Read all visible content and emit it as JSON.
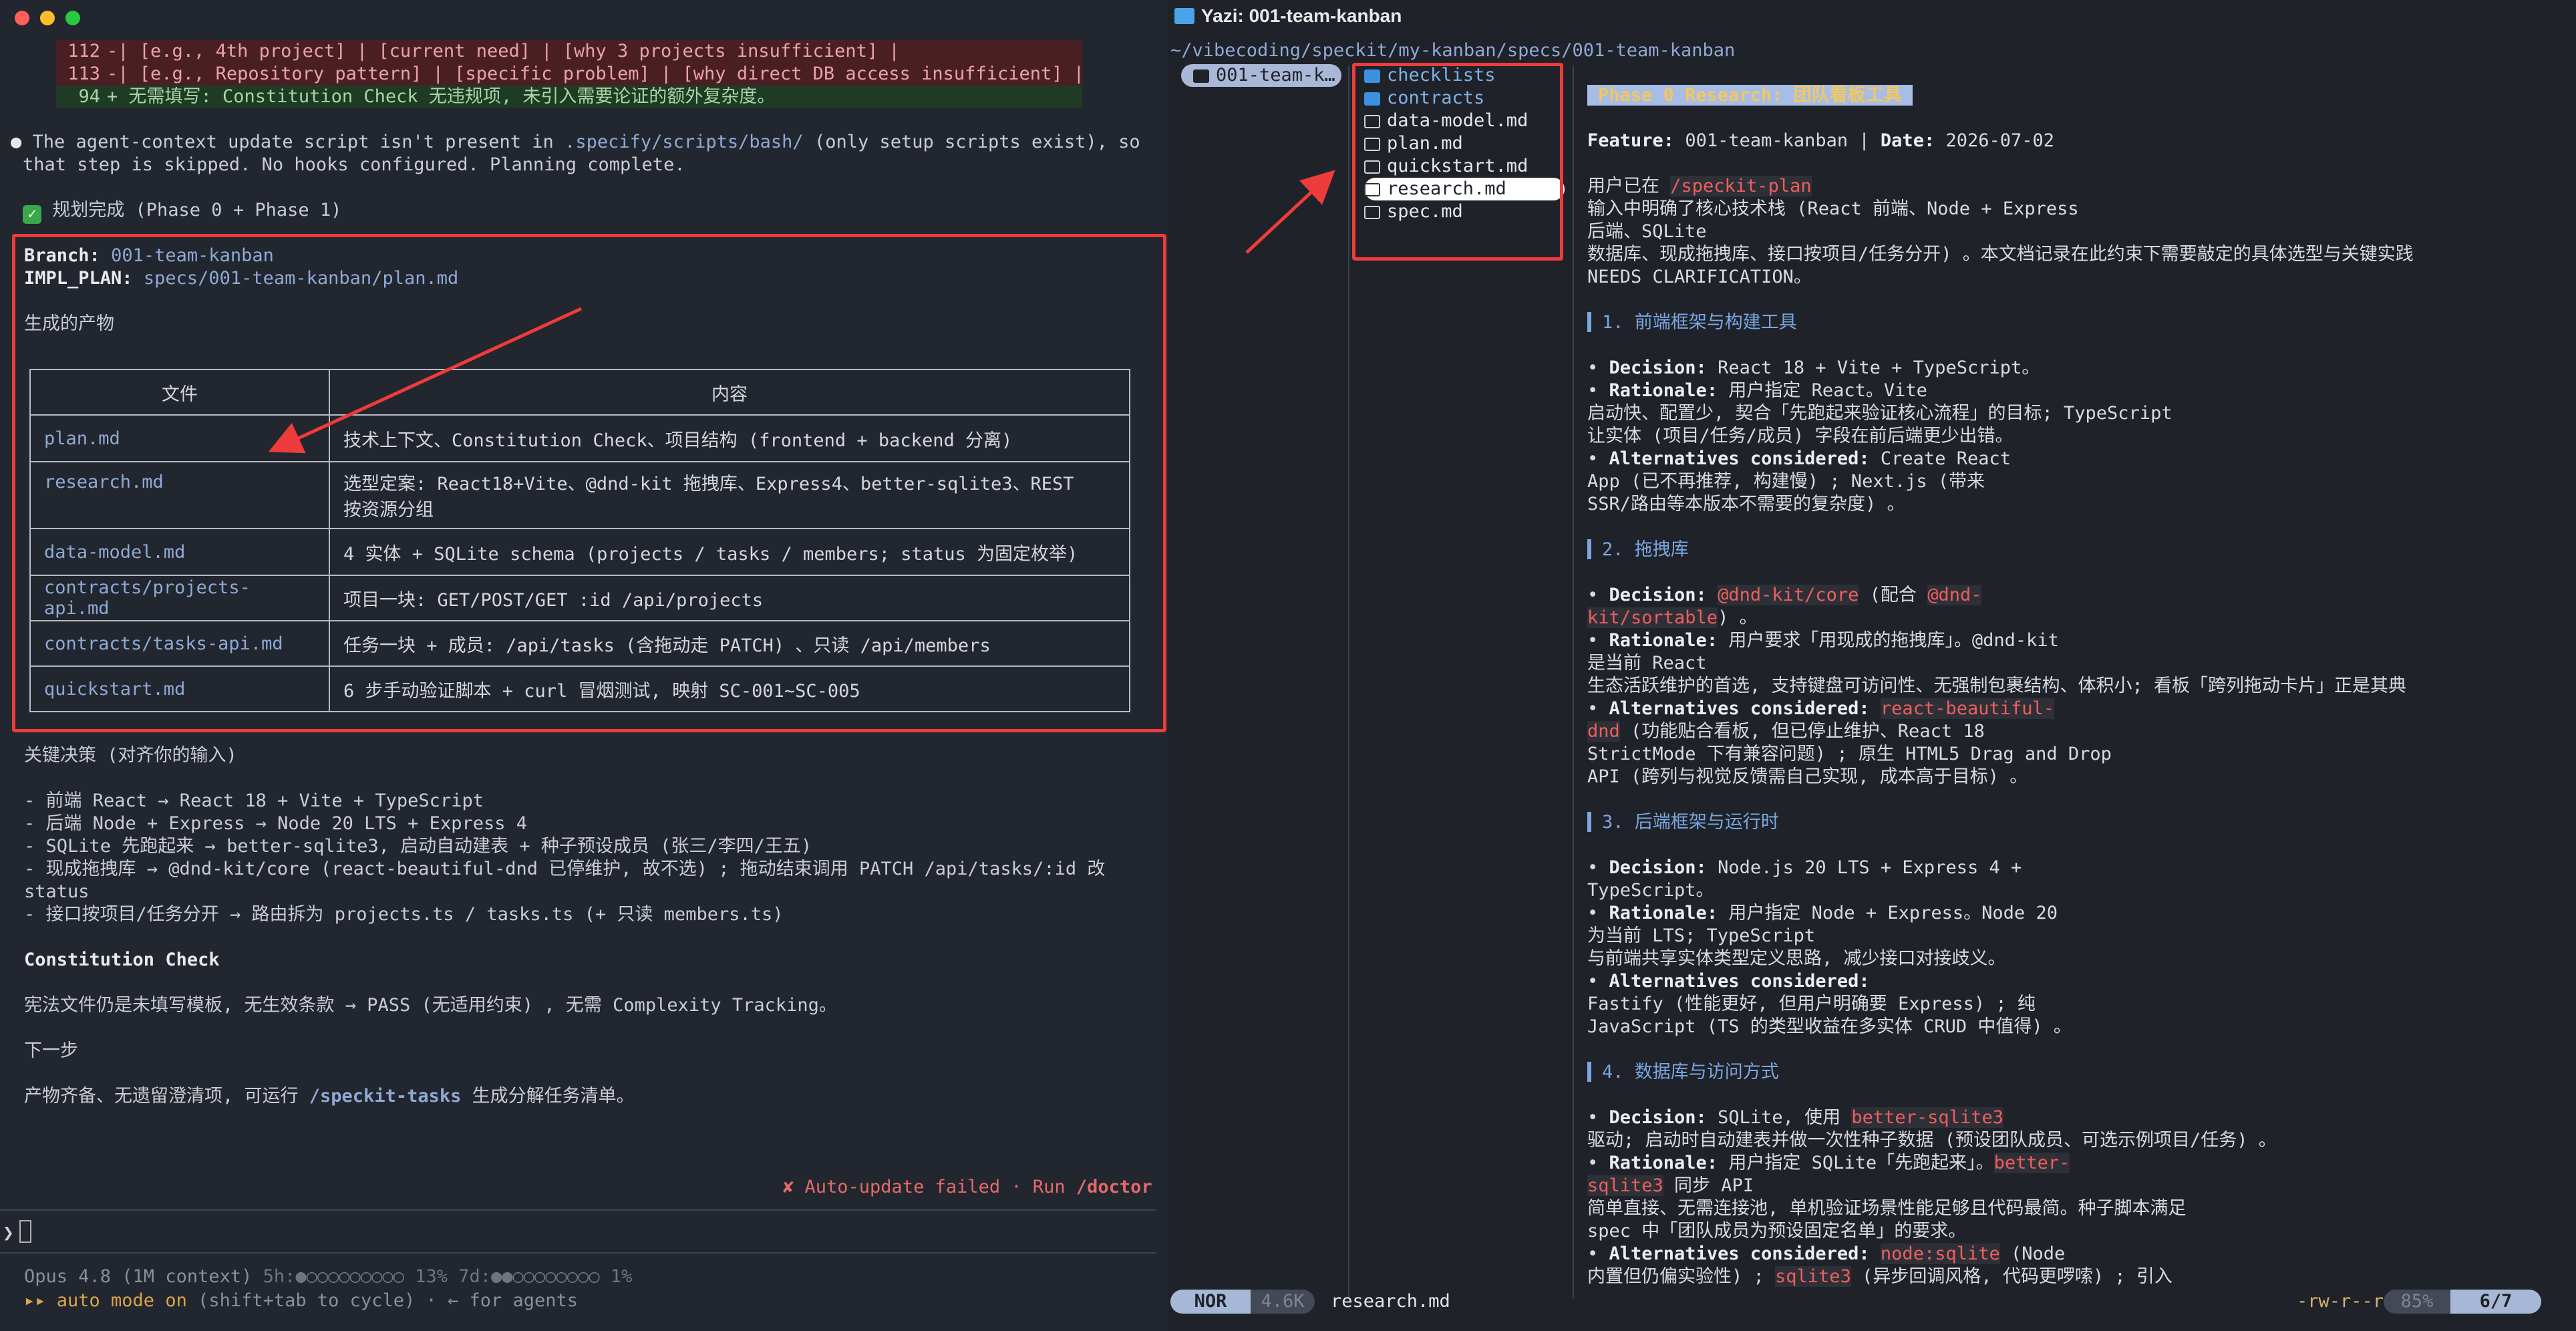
{
  "left": {
    "diff": [
      {
        "num": "112",
        "sign": "-",
        "text": "| [e.g., 4th project] | [current need] | [why 3 projects insufficient] |",
        "type": "del"
      },
      {
        "num": "113",
        "sign": "-",
        "text": "| [e.g., Repository pattern] | [specific problem] | [why direct DB access insufficient] |",
        "type": "del"
      },
      {
        "num": "94",
        "sign": "+",
        "text": "无需填写: Constitution Check 无违规项, 未引入需要论证的额外复杂度。",
        "type": "add"
      }
    ],
    "note_a": "The agent-context update script isn't present in",
    "note_path": ".specify/scripts/bash/",
    "note_b": "(only setup scripts exist), so",
    "note_c": "that step is skipped. No hooks configured. Planning complete.",
    "done_title": "规划完成 (Phase 0 + Phase 1)",
    "branch_label": "Branch:",
    "branch_value": "001-team-kanban",
    "impl_label": "IMPL_PLAN:",
    "impl_value": "specs/001-team-kanban/plan.md",
    "artifacts_title": "生成的产物",
    "table": {
      "col_file": "文件",
      "col_content": "内容",
      "rows": [
        {
          "file": "plan.md",
          "content": "技术上下文、Constitution Check、项目结构 (frontend + backend 分离)"
        },
        {
          "file": "research.md",
          "content": "选型定案: React18+Vite、@dnd-kit 拖拽库、Express4、better-sqlite3、REST",
          "content2": "按资源分组"
        },
        {
          "file": "data-model.md",
          "content": "4 实体 + SQLite schema (projects / tasks / members; status 为固定枚举)"
        },
        {
          "file": "contracts/projects-api.md",
          "content": "项目一块: GET/POST/GET :id /api/projects"
        },
        {
          "file": "contracts/tasks-api.md",
          "content": "任务一块 + 成员: /api/tasks (含拖动走 PATCH) 、只读 /api/members"
        },
        {
          "file": "quickstart.md",
          "content": "6 步手动验证脚本 + curl 冒烟测试, 映射 SC-001~SC-005"
        }
      ]
    },
    "decisions_title": "关键决策 (对齐你的输入)",
    "decisions": [
      "- 前端 React → React 18 + Vite + TypeScript",
      "- 后端 Node + Express → Node 20 LTS + Express 4",
      "- SQLite 先跑起来 → better-sqlite3, 启动自动建表 + 种子预设成员 (张三/李四/王五)",
      "- 现成拖拽库 → @dnd-kit/core (react-beautiful-dnd 已停维护, 故不选) ; 拖动结束调用 PATCH /api/tasks/:id 改",
      "status",
      "- 接口按项目/任务分开 → 路由拆为 projects.ts / tasks.ts (+ 只读 members.ts)"
    ],
    "constitution_title": "Constitution Check",
    "constitution_text": "宪法文件仍是未填写模板, 无生效条款 → PASS (无适用约束) , 无需 Complexity Tracking。",
    "next_title": "下一步",
    "next_text_a": "产物齐备、无遗留澄清项, 可运行",
    "next_cmd": "/speckit-tasks",
    "next_text_b": "生成分解任务清单。",
    "autoupdate_a": "✘ Auto-update failed · Run",
    "autoupdate_cmd": "/doctor",
    "model_line": "Opus 4.8 (1M context)",
    "usage_5h": "5h:●○○○○○○○○○ 13%",
    "usage_7d": "7d:●●○○○○○○○○ 1%",
    "auto_mode_a": "▸▸ auto mode on",
    "auto_mode_b": "(shift+tab to cycle) · ← for agents",
    "prompt_symbol": "❯"
  },
  "right": {
    "title": "Yazi: 001-team-kanban",
    "cwd": "~/vibecoding/speckit/my-kanban/specs/001-team-kanban",
    "parent_selected": "001-team-k…",
    "entries": [
      {
        "name": "checklists",
        "kind": "dir"
      },
      {
        "name": "contracts",
        "kind": "dir"
      },
      {
        "name": "data-model.md",
        "kind": "file"
      },
      {
        "name": "plan.md",
        "kind": "file"
      },
      {
        "name": "quickstart.md",
        "kind": "file"
      },
      {
        "name": "research.md",
        "kind": "file",
        "selected": true
      },
      {
        "name": "spec.md",
        "kind": "file"
      }
    ],
    "preview": {
      "h1": "Phase 0 Research: 团队看板工具",
      "feature_label": "Feature:",
      "feature_value": "001-team-kanban | ",
      "date_label": "Date:",
      "date_value": "2026-07-02",
      "intro_a": "用户已在",
      "intro_code": "/speckit-plan",
      "intro_lines": [
        "输入中明确了核心技术栈 (React 前端、Node + Express",
        "后端、SQLite",
        "数据库、现成拖拽库、接口按项目/任务分开) 。本文档记录在此约束下需要敲定的具体选型与关键实践",
        "NEEDS CLARIFICATION。"
      ],
      "s1_title": "1. 前端框架与构建工具",
      "s1_lines": [
        [
          "• ",
          "Decision:",
          " React 18 + Vite + TypeScript。"
        ],
        [
          "• ",
          "Rationale:",
          " 用户指定 React。Vite"
        ],
        [
          "",
          "",
          "启动快、配置少, 契合「先跑起来验证核心流程」的目标; TypeScript"
        ],
        [
          "",
          "",
          "让实体 (项目/任务/成员) 字段在前后端更少出错。"
        ],
        [
          "• ",
          "Alternatives considered:",
          " Create React"
        ],
        [
          "",
          "",
          "App (已不再推荐, 构建慢) ; Next.js (带来"
        ],
        [
          "",
          "",
          "SSR/路由等本版本不需要的复杂度) 。"
        ]
      ],
      "s2_title": "2. 拖拽库",
      "s2_decision_code1": "@dnd-kit/core",
      "s2_decision_mid": " (配合 ",
      "s2_decision_code2a": "@dnd-",
      "s2_decision_code2b": "kit/sortable",
      "s2_decision_end": ") 。",
      "s2_rationale": " 用户要求「用现成的拖拽库」。@dnd-kit",
      "s2_r2": "是当前 React",
      "s2_r3": "生态活跃维护的首选, 支持键盘可访问性、无强制包裹结构、体积小; 看板「跨列拖动卡片」正是其典",
      "s2_alt_code_a": "react-beautiful-",
      "s2_alt_code_b": "dnd",
      "s2_alt_r": " (功能贴合看板, 但已停止维护、React 18",
      "s2_a2": "StrictMode 下有兼容问题) ; 原生 HTML5 Drag and Drop",
      "s2_a3": "API (跨列与视觉反馈需自己实现, 成本高于目标) 。",
      "s3_title": "3. 后端框架与运行时",
      "s3_lines": [
        [
          "• ",
          "Decision:",
          " Node.js 20 LTS + Express 4 +"
        ],
        [
          "",
          "",
          "TypeScript。"
        ],
        [
          "• ",
          "Rationale:",
          " 用户指定 Node + Express。Node 20"
        ],
        [
          "",
          "",
          "为当前 LTS; TypeScript"
        ],
        [
          "",
          "",
          "与前端共享实体类型定义思路, 减少接口对接歧义。"
        ],
        [
          "• ",
          "Alternatives considered:",
          ""
        ],
        [
          "",
          "",
          "Fastify (性能更好, 但用户明确要 Express) ; 纯"
        ],
        [
          "",
          "",
          "JavaScript (TS 的类型收益在多实体 CRUD 中值得) 。"
        ]
      ],
      "s4_title": "4. 数据库与访问方式",
      "s4_decision_a": " SQLite, 使用 ",
      "s4_decision_code": "better-sqlite3",
      "s4_d2": "驱动; 启动时自动建表并做一次性种子数据 (预设团队成员、可选示例项目/任务) 。",
      "s4_rationale": " 用户指定 SQLite「先跑起来」。",
      "s4_r_code_a": "better-",
      "s4_r_code_b": "sqlite3",
      "s4_r_b": " 同步 API",
      "s4_r3": "简单直接、无需连接池, 单机验证场景性能足够且代码最简。种子脚本满足",
      "s4_r4": "spec 中「团队成员为预设固定名单」的要求。",
      "s4_alt_code": "node:sqlite",
      "s4_alt_b": " (Node",
      "s4_a2a": "内置但仍偏实验性) ; ",
      "s4_a2_code": "sqlite3",
      "s4_a2b": " (异步回调风格, 代码更啰嗦) ; 引入"
    },
    "status": {
      "mode": "NOR",
      "size": "4.6K",
      "file": "research.md",
      "perms": "-rw-r--r--",
      "percent": "85%",
      "position": "6/7"
    }
  }
}
